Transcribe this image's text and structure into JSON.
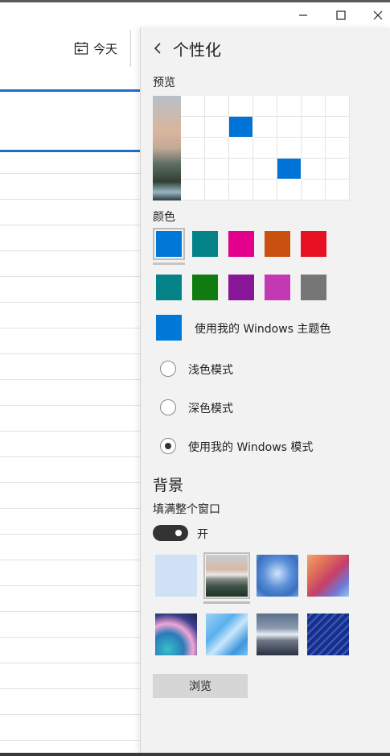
{
  "window": {
    "minimize_icon": "minimize-icon",
    "maximize_icon": "maximize-icon",
    "close_icon": "close-icon"
  },
  "calendar": {
    "today_label": "今天",
    "today_icon": "calendar-today-icon"
  },
  "panel": {
    "title": "个性化",
    "back_icon": "back-arrow-icon",
    "preview_label": "预览",
    "colors_label": "颜色",
    "accent_colors": [
      "#0078d7",
      "#038387",
      "#e3008c",
      "#ca5010",
      "#e81123",
      "#038387",
      "#107c10",
      "#881798",
      "#c239b3",
      "#767676"
    ],
    "selected_color_index": 0,
    "windows_theme_color": "#0078d7",
    "windows_theme_color_label": "使用我的 Windows 主题色",
    "modes": [
      {
        "label": "浅色模式",
        "checked": false
      },
      {
        "label": "深色模式",
        "checked": false
      },
      {
        "label": "使用我的 Windows 模式",
        "checked": true
      }
    ],
    "background_heading": "背景",
    "fill_window_label": "填满整个窗口",
    "toggle_state": "开",
    "selected_background_index": 1,
    "browse_label": "浏览"
  }
}
